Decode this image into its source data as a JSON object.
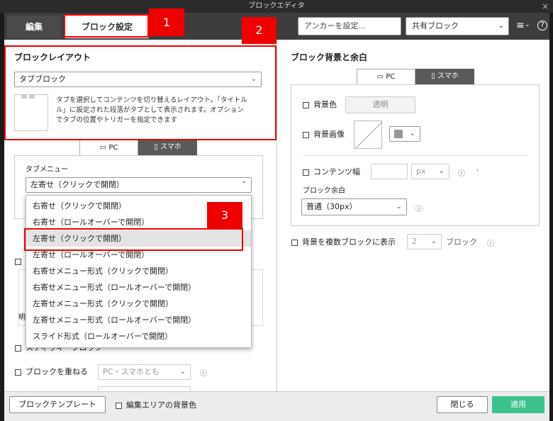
{
  "window": {
    "title": "ブロックエディタ",
    "close": "×"
  },
  "tabs": {
    "edit": "編集",
    "block_settings": "ブロック設定"
  },
  "header": {
    "anchor_placeholder": "アンカーを設定...",
    "shared_select": "共有ブロック",
    "menu_glyph": "≡",
    "help_glyph": "?"
  },
  "badges": [
    "1",
    "2",
    "3"
  ],
  "left": {
    "layout_title": "ブロックレイアウト",
    "layout_value": "タブブロック",
    "layout_desc_1": "タブを選択してコンテンツを切り替えるレイアウト。「タイトル",
    "layout_desc_2": "ル」に設定された段落がタブとして表示されます。オプション",
    "layout_desc_3": "でタブの位置やトリガーを指定できます",
    "pc_tab": "PC",
    "sp_tab": "スマホ",
    "tab_menu_label": "タブメニュー",
    "tab_menu_value": "左寄せ（クリックで開閉）",
    "hidden_label_fragment": "明",
    "stack_label": "ブロックを重ねる",
    "stack_value": "PC・スマホとも",
    "partial_label": "スティッキーブロック"
  },
  "dropdown": {
    "items": [
      "右寄せ（クリックで開閉）",
      "右寄せ（ロールオーバーで開閉）",
      "左寄せ（クリックで開閉）",
      "左寄せ（ロールオーバーで開閉）",
      "右寄せメニュー形式（クリックで開閉）",
      "右寄せメニュー形式（ロールオーバーで開閉）",
      "左寄せメニュー形式（クリックで開閉）",
      "左寄せメニュー形式（ロールオーバーで開閉）",
      "スライド形式（ロールオーバーで開閉）"
    ],
    "selected_index": 2
  },
  "right": {
    "title": "ブロック背景と余白",
    "pc_tab": "PC",
    "sp_tab": "スマホ",
    "bg_color_label": "背景色",
    "bg_color_value": "透明",
    "bg_image_label": "背景画像",
    "content_width_label": "コンテンツ幅",
    "content_width_unit": "px",
    "block_margin_label": "ブロック余白",
    "block_margin_value": "普通（30px）",
    "multi_label": "背景を複数ブロックに表示",
    "multi_value": "2",
    "multi_unit": "ブロック"
  },
  "footer": {
    "template_button": "ブロックテンプレート",
    "edit_bg_label": "編集エリアの背景色",
    "close_button": "閉じる",
    "apply_button": "適用"
  },
  "colors": {
    "accent_red": "#ee0000",
    "apply_green": "#3cc18c",
    "dark_bar": "#3d3d3d"
  }
}
